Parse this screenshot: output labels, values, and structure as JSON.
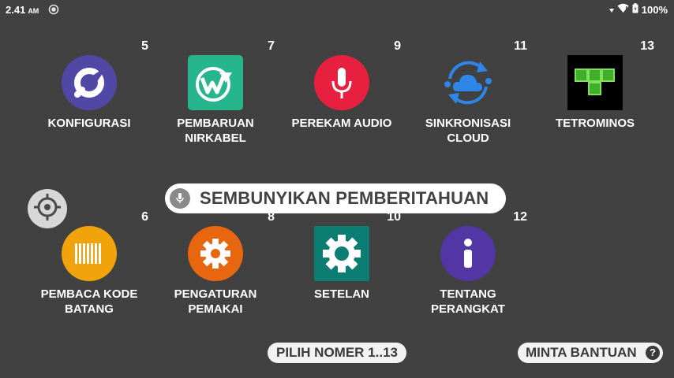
{
  "status_bar": {
    "time": "2.41",
    "ampm": "AM",
    "battery": "100%"
  },
  "apps": [
    {
      "number": "5",
      "label_line1": "KONFIGURASI",
      "label_line2": "",
      "color": "#5148a6",
      "icon": "wrench-icon"
    },
    {
      "number": "7",
      "label_line1": "PEMBARUAN",
      "label_line2": "NIRKABEL",
      "color": "#26b58c",
      "icon": "wireless-update-icon"
    },
    {
      "number": "9",
      "label_line1": "PEREKAM AUDIO",
      "label_line2": "",
      "color": "#e8203f",
      "icon": "microphone-icon"
    },
    {
      "number": "11",
      "label_line1": "SINKRONISASI",
      "label_line2": "CLOUD",
      "color": "#2d86e8",
      "icon": "cloud-sync-icon"
    },
    {
      "number": "13",
      "label_line1": "TETROMINOS",
      "label_line2": "",
      "color": "#000000",
      "icon": "tetromino-icon"
    },
    {
      "number": "6",
      "label_line1": "PEMBACA KODE",
      "label_line2": "BATANG",
      "color": "#f0a30b",
      "icon": "barcode-icon"
    },
    {
      "number": "8",
      "label_line1": "PENGATURAN",
      "label_line2": "PEMAKAI",
      "color": "#e8660f",
      "icon": "gear-icon"
    },
    {
      "number": "10",
      "label_line1": "SETELAN",
      "label_line2": "",
      "color": "#0b7d72",
      "icon": "settings-icon"
    },
    {
      "number": "12",
      "label_line1": "TENTANG",
      "label_line2": "PERANGKAT",
      "color": "#5236a3",
      "icon": "info-icon"
    }
  ],
  "notification_banner": {
    "text": "SEMBUNYIKAN PEMBERITAHUAN"
  },
  "bottom": {
    "choose_number": "PILIH NOMER 1..13",
    "help": "MINTA BANTUAN",
    "help_icon": "?"
  }
}
